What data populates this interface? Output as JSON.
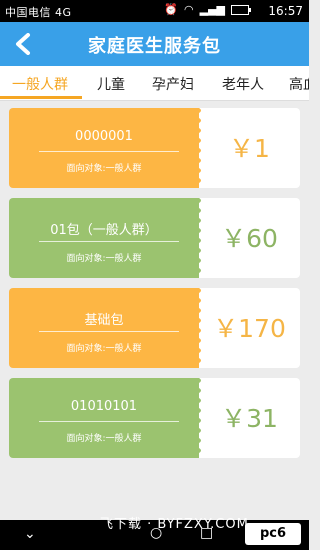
{
  "statusbar": {
    "carrier": "中国电信 4G",
    "time": "16:57"
  },
  "header": {
    "title": "家庭医生服务包"
  },
  "tabs": [
    {
      "label": "一般人群",
      "active": true
    },
    {
      "label": "儿童",
      "active": false
    },
    {
      "label": "孕产妇",
      "active": false
    },
    {
      "label": "老年人",
      "active": false
    },
    {
      "label": "高血",
      "active": false
    }
  ],
  "packages": [
    {
      "name": "0000001",
      "target": "面向对象:一般人群",
      "price": "￥1",
      "color": "orange"
    },
    {
      "name": "01包（一般人群）",
      "target": "面向对象:一般人群",
      "price": "￥60",
      "color": "green"
    },
    {
      "name": "基础包",
      "target": "面向对象:一般人群",
      "price": "￥170",
      "color": "orange"
    },
    {
      "name": "01010101",
      "target": "面向对象:一般人群",
      "price": "￥31",
      "color": "green"
    }
  ],
  "colors": {
    "header": "#39a0e8",
    "accent": "#f5a623",
    "card_orange": "#fdb644",
    "card_green": "#9bc36f"
  },
  "watermark": "飞下载 · BYFZXY.COM",
  "logo": "pc6"
}
